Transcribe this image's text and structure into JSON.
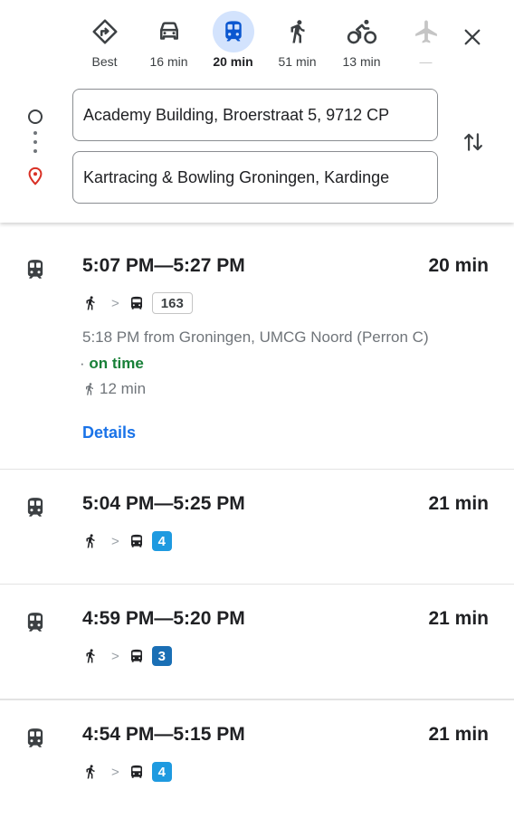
{
  "travel_modes": [
    {
      "label": "Best",
      "icon": "best-route-icon",
      "active": false
    },
    {
      "label": "16 min",
      "icon": "car-icon",
      "active": false
    },
    {
      "label": "20 min",
      "icon": "transit-icon",
      "active": true
    },
    {
      "label": "51 min",
      "icon": "walk-icon",
      "active": false
    },
    {
      "label": "13 min",
      "icon": "bicycle-icon",
      "active": false
    },
    {
      "label": "—",
      "icon": "flight-icon",
      "active": false
    }
  ],
  "search": {
    "origin_value": "Academy Building, Broerstraat 5, 9712 CP",
    "destination_value": "Kartracing & Bowling Groningen, Kardinge"
  },
  "routes": [
    {
      "time_range": "5:07 PM—5:27 PM",
      "duration": "20 min",
      "bus_line": "163",
      "departure": "5:18 PM from Groningen, UMCG Noord (Perron C)",
      "status_separator": "·",
      "status": "on time",
      "walk_time": "12 min",
      "details_label": "Details"
    },
    {
      "time_range": "5:04 PM—5:25 PM",
      "duration": "21 min",
      "bus_line": "4"
    },
    {
      "time_range": "4:59 PM—5:20 PM",
      "duration": "21 min",
      "bus_line": "3"
    },
    {
      "time_range": "4:54 PM—5:15 PM",
      "duration": "21 min",
      "bus_line": "4"
    }
  ],
  "colors": {
    "active_mode_bg": "#d3e3fd",
    "transit_active": "#0b57d0",
    "on_time_green": "#188038",
    "link_blue": "#1a73e8",
    "destination_pin_red": "#d93025",
    "line_4_bg": "#1e9ae0",
    "line_3_bg": "#1a6fb5"
  }
}
